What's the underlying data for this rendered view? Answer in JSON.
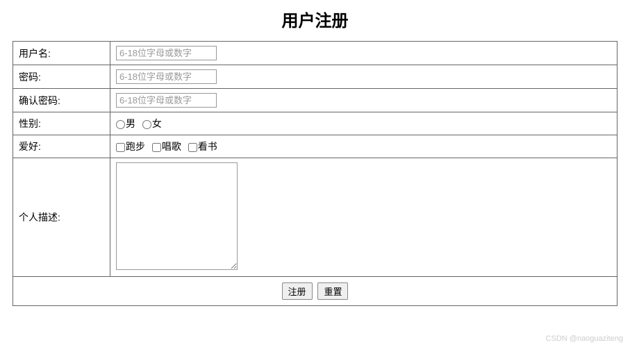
{
  "title": "用户注册",
  "fields": {
    "username": {
      "label": "用户名:",
      "placeholder": "6-18位字母或数字"
    },
    "password": {
      "label": "密码:",
      "placeholder": "6-18位字母或数字"
    },
    "confirm": {
      "label": "确认密码:",
      "placeholder": "6-18位字母或数字"
    },
    "gender": {
      "label": "性别:",
      "options": [
        "男",
        "女"
      ]
    },
    "hobby": {
      "label": "爱好:",
      "options": [
        "跑步",
        "唱歌",
        "看书"
      ]
    },
    "description": {
      "label": "个人描述:"
    }
  },
  "buttons": {
    "submit": "注册",
    "reset": "重置"
  },
  "watermark": "CSDN @naoguaziteng"
}
